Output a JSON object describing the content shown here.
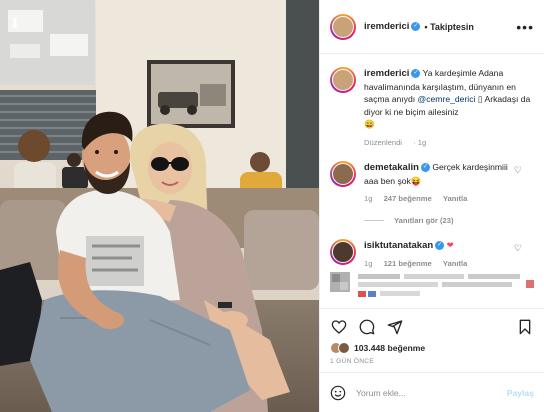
{
  "post": {
    "author": "iremderici",
    "follow_status": "Takiptesin",
    "more_icon": "ellipsis-icon"
  },
  "caption": {
    "author": "iremderici",
    "text_before": "Ya kardeşimle Adana havalimanında karşılaştım, dünyanın en saçma anıydı",
    "mention": "@cemre_derici",
    "text_after": "Arkadaşı da diyor ki ne biçim ailesiniz",
    "emoji": "😄",
    "edited_label": "Düzenlendi",
    "time": "1g"
  },
  "comments": [
    {
      "user": "demetakalin",
      "text": "Gerçek kardeşinmiii aaa ben şok",
      "emoji": "😝",
      "time": "1g",
      "likes": "247 beğenme",
      "reply_label": "Yanıtla",
      "view_replies": "Yanıtları gör (23)"
    },
    {
      "user": "isiktutanatakan",
      "emoji": "❤",
      "time": "1g",
      "likes": "121 beğenme",
      "reply_label": "Yanıtla"
    }
  ],
  "likes": {
    "count_text": "103.448 beğenme",
    "time_ago": "1 GÜN ÖNCE"
  },
  "comment_box": {
    "placeholder": "Yorum ekle...",
    "post_label": "Paylaş"
  },
  "colors": {
    "accent_blue": "#3897f0",
    "link_blue": "#00376b",
    "muted": "#8e8e8e",
    "post_disabled": "#b2dffc",
    "heart_red": "#ed4956"
  }
}
